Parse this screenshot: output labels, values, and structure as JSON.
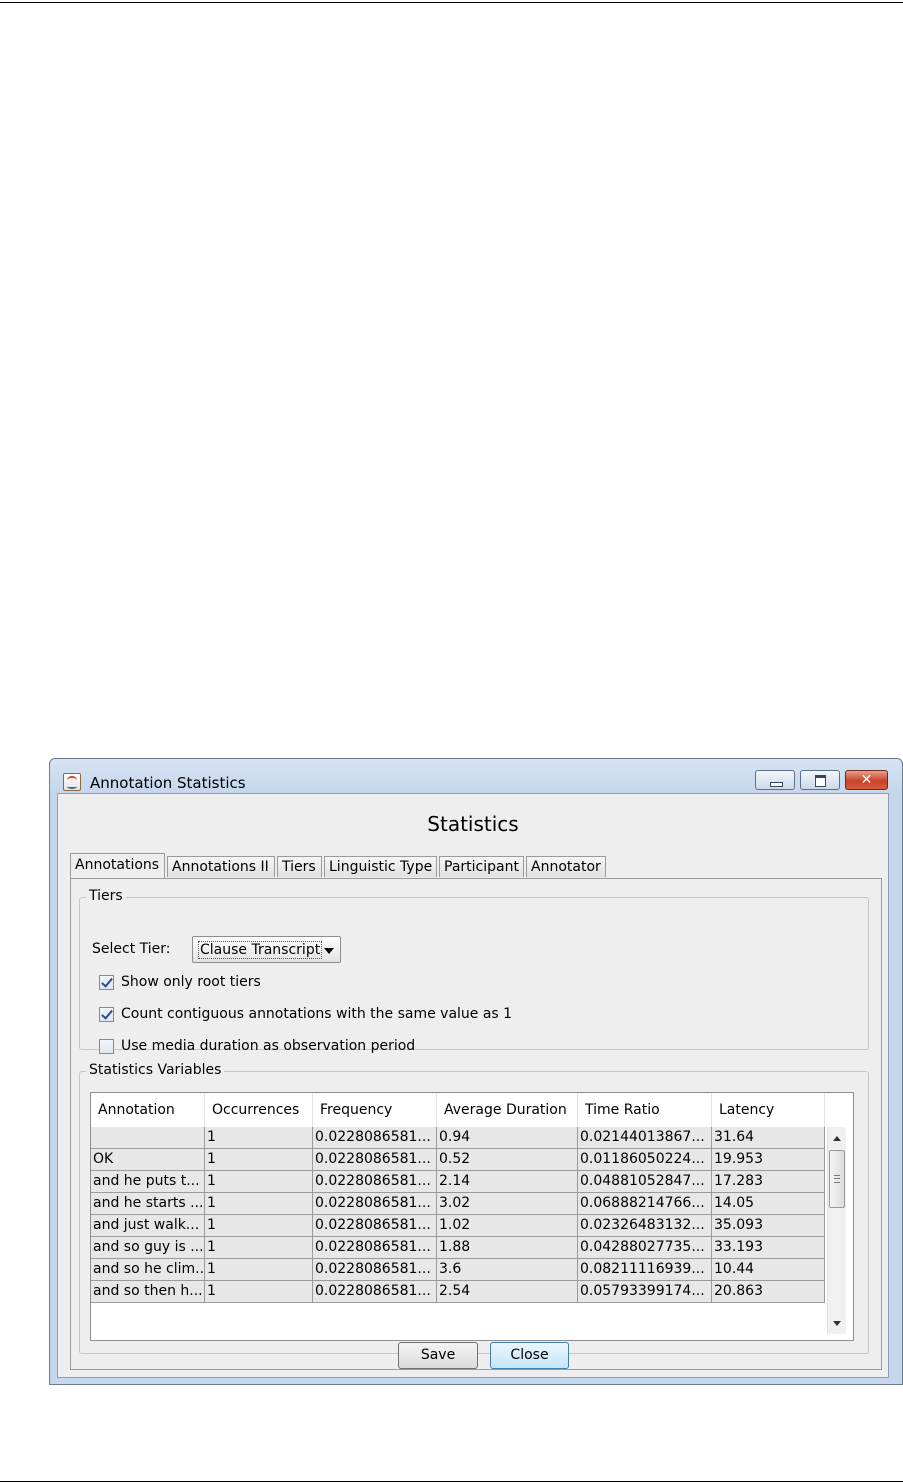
{
  "window": {
    "title": "Annotation Statistics",
    "close_glyph": "✕"
  },
  "heading": "Statistics",
  "tabs": [
    {
      "label": "Annotations"
    },
    {
      "label": "Annotations II"
    },
    {
      "label": "Tiers"
    },
    {
      "label": "Linguistic Type"
    },
    {
      "label": "Participant"
    },
    {
      "label": "Annotator"
    }
  ],
  "tiers_group": {
    "title": "Tiers",
    "select_label": "Select Tier:",
    "select_value": "Clause Transcript",
    "options": [
      {
        "label": "Show only root tiers",
        "checked": true
      },
      {
        "label": "Count contiguous annotations with the same value as 1",
        "checked": true
      },
      {
        "label": "Use media duration as observation period",
        "checked": false
      }
    ]
  },
  "vars_group": {
    "title": "Statistics Variables",
    "columns": [
      "Annotation",
      "Occurrences",
      "Frequency",
      "Average Duration",
      "Time Ratio",
      "Latency"
    ],
    "rows": [
      [
        "",
        "1",
        "0.0228086581...",
        "0.94",
        "0.02144013867...",
        "31.64"
      ],
      [
        "OK",
        "1",
        "0.0228086581...",
        "0.52",
        "0.01186050224...",
        "19.953"
      ],
      [
        "and he puts t...",
        "1",
        "0.0228086581...",
        "2.14",
        "0.04881052847...",
        "17.283"
      ],
      [
        "and he starts ...",
        "1",
        "0.0228086581...",
        "3.02",
        "0.06888214766...",
        "14.05"
      ],
      [
        "and just walk...",
        "1",
        "0.0228086581...",
        "1.02",
        "0.02326483132...",
        "35.093"
      ],
      [
        "and so guy is ...",
        "1",
        "0.0228086581...",
        "1.88",
        "0.04288027735...",
        "33.193"
      ],
      [
        "and so he clim...",
        "1",
        "0.0228086581...",
        "3.6",
        "0.08211116939...",
        "10.44"
      ],
      [
        "and so then h...",
        "1",
        "0.0228086581...",
        "2.54",
        "0.05793399174...",
        "20.863"
      ]
    ]
  },
  "buttons": {
    "save": "Save",
    "close": "Close"
  }
}
